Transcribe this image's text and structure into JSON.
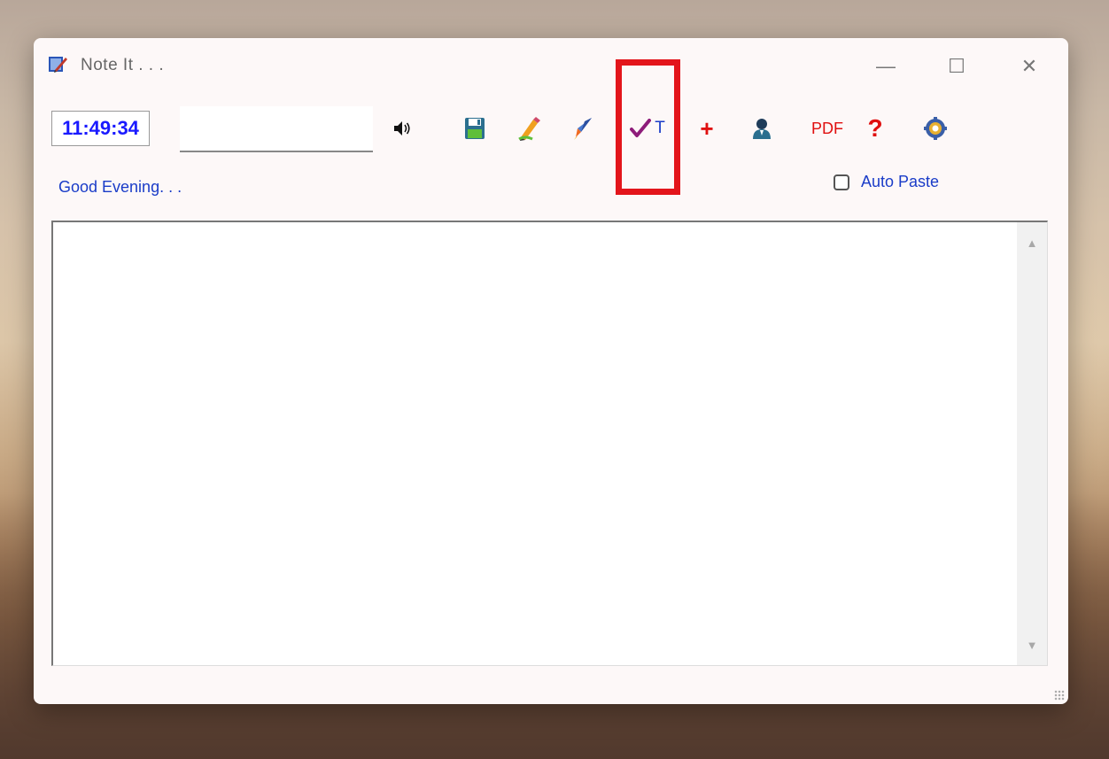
{
  "window": {
    "title": "Note It . . .",
    "controls": {
      "minimize": "—",
      "maximize": "☐",
      "close": "✕"
    }
  },
  "toolbar": {
    "clock": "11:49:34",
    "input_value": "",
    "input_placeholder": "",
    "check_t_label": "T",
    "plus_label": "+",
    "pdf_label": "PDF",
    "help_label": "?",
    "icons": [
      "speaker-icon",
      "save-icon",
      "pencil-icon",
      "rocket-icon",
      "check-t-icon",
      "plus-icon",
      "user-icon",
      "pdf-icon",
      "help-icon",
      "gear-icon"
    ]
  },
  "content": {
    "greeting": "Good Evening. . .",
    "auto_paste_label": "Auto Paste",
    "auto_paste_checked": false,
    "editor_text": ""
  },
  "scrollbar": {
    "up": "▲",
    "down": "▼"
  },
  "colors": {
    "accent_blue": "#1a3cc8",
    "clock_blue": "#1a1aff",
    "red": "#e01010",
    "highlight": "#e3151b"
  }
}
